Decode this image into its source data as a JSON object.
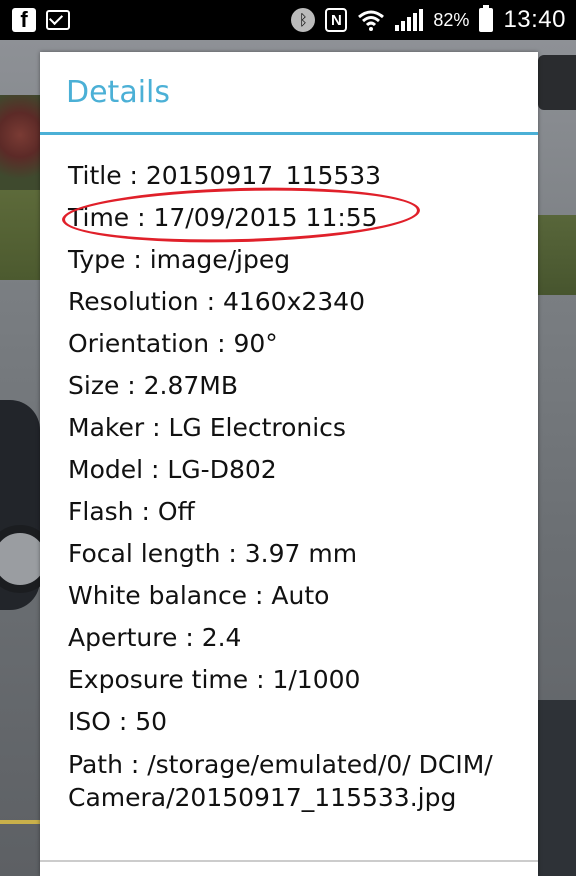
{
  "status_bar": {
    "battery": "82%",
    "time": "13:40",
    "icons": [
      "facebook-icon",
      "gmail-icon",
      "bluetooth-icon",
      "nfc-icon",
      "wifi-icon",
      "signal-icon",
      "battery-icon"
    ]
  },
  "dialog": {
    "title": "Details",
    "rows": [
      "Title : 20150917_115533",
      "Time : 17/09/2015 11:55",
      "Type : image/jpeg",
      "Resolution : 4160x2340",
      "Orientation : 90°",
      "Size : 2.87MB",
      "Maker : LG Electronics",
      "Model : LG-D802",
      "Flash : Off",
      "Focal length : 3.97 mm",
      "White balance : Auto",
      "Aperture : 2.4",
      "Exposure time : 1/1000",
      "ISO : 50",
      "Path : /storage/emulated/0/ DCIM/ Camera/20150917_115533.jpg"
    ]
  },
  "colors": {
    "accent": "#4bb0d6",
    "annotation": "#e0202a"
  }
}
